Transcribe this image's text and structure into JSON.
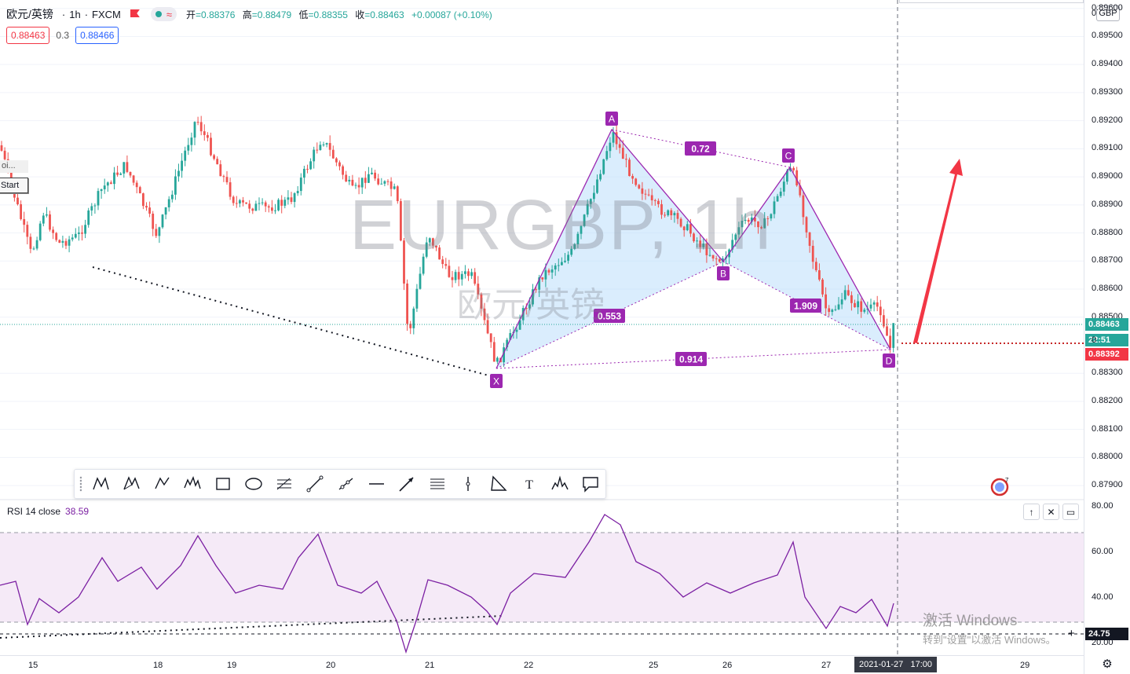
{
  "legend": {
    "symbol": "欧元/英镑",
    "interval": "1h",
    "exchange": "FXCM",
    "ohlc": [
      {
        "label": "开",
        "value": "=0.88376"
      },
      {
        "label": "高",
        "value": "=0.88479"
      },
      {
        "label": "低",
        "value": "=0.88355"
      },
      {
        "label": "收",
        "value": "=0.88463"
      }
    ],
    "change": "+0.00087 (+0.10%)",
    "bid": "0.88463",
    "spread": "0.3",
    "ask": "0.88466"
  },
  "side_panel": {
    "label": "oi...",
    "start_button": "Start"
  },
  "watermark": {
    "main": "EURGBP, 1h",
    "sub": "欧元/英镑"
  },
  "currency_button": "GBP",
  "price_axis": {
    "ticks": [
      "0.89600",
      "0.89500",
      "0.89400",
      "0.89300",
      "0.89200",
      "0.89100",
      "0.89000",
      "0.88900",
      "0.88800",
      "0.88700",
      "0.88600",
      "0.88500",
      "0.88300",
      "0.88200",
      "0.88100",
      "0.88000",
      "0.87900"
    ],
    "last_price": "0.88463",
    "countdown": "22:51",
    "pattern_low": "0.88392",
    "partial_top": "0"
  },
  "time_axis": {
    "ticks": [
      "15",
      "18",
      "19",
      "20",
      "21",
      "22",
      "25",
      "26",
      "27",
      "29"
    ],
    "crosshair_date": "2021-01-27",
    "crosshair_time": "17:00"
  },
  "pattern": {
    "points": [
      "X",
      "A",
      "B",
      "C",
      "D"
    ],
    "ratios": {
      "xab": "0.553",
      "abc": "0.72",
      "bcd": "1.909",
      "xad": "0.914"
    }
  },
  "toolbar": {
    "tools": [
      "xabcd-pattern-icon",
      "cypher-pattern-icon",
      "abcd-pattern-icon",
      "elliott-wave-icon",
      "rectangle-icon",
      "ellipse-icon",
      "fib-retracement-icon",
      "trend-line-icon",
      "ray-icon",
      "horizontal-ray-icon",
      "arrow-icon",
      "parallel-channel-icon",
      "vertical-line-icon",
      "triangle-icon",
      "text-icon",
      "head-shoulders-icon",
      "callout-icon"
    ],
    "text_tool_label": "T"
  },
  "rsi": {
    "label": "RSI 14 close",
    "value": "38.59",
    "axis_ticks": [
      "80.00",
      "60.00",
      "40.00",
      "20.00"
    ],
    "cursor_value": "24.75",
    "color": "#7b1fa2"
  },
  "windows_activation": {
    "line1": "激活 Windows",
    "line2": "转到\"设置\"以激活 Windows。"
  },
  "colors": {
    "up": "#26a69a",
    "down": "#ef5350",
    "pattern": "#9c27b0",
    "pattern_fill": "#bbdefb",
    "arrow": "#f23645",
    "last_price": "#26a69a"
  },
  "chart_data": {
    "type": "candlestick",
    "series": [
      {
        "name": "EURGBP 1h",
        "close_last": 0.88463
      }
    ],
    "x_label": "",
    "y_label": "",
    "ylim": [
      0.8785,
      0.8963
    ],
    "rsi_ylim": [
      15,
      83
    ],
    "rsi_bands": [
      30,
      70
    ]
  }
}
